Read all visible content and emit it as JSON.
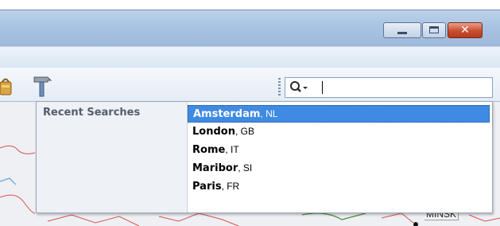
{
  "window": {
    "minimize_label": "",
    "maximize_label": "",
    "close_glyph": "✕"
  },
  "toolbar": {
    "search": {
      "value": "",
      "placeholder": ""
    }
  },
  "dropdown": {
    "heading": "Recent Searches",
    "items": [
      {
        "city": "Amsterdam",
        "country": ", NL",
        "selected": true
      },
      {
        "city": "London",
        "country": ", GB",
        "selected": false
      },
      {
        "city": "Rome",
        "country": ", IT",
        "selected": false
      },
      {
        "city": "Maribor",
        "country": ", SI",
        "selected": false
      },
      {
        "city": "Paris",
        "country": ", FR",
        "selected": false
      }
    ]
  },
  "map": {
    "city_label": "MINSK"
  },
  "colors": {
    "selection": "#3f8ae2",
    "titlebar": "#a9c3e2",
    "close_button": "#c94e2f",
    "map_border_lines": "#d9534f"
  }
}
